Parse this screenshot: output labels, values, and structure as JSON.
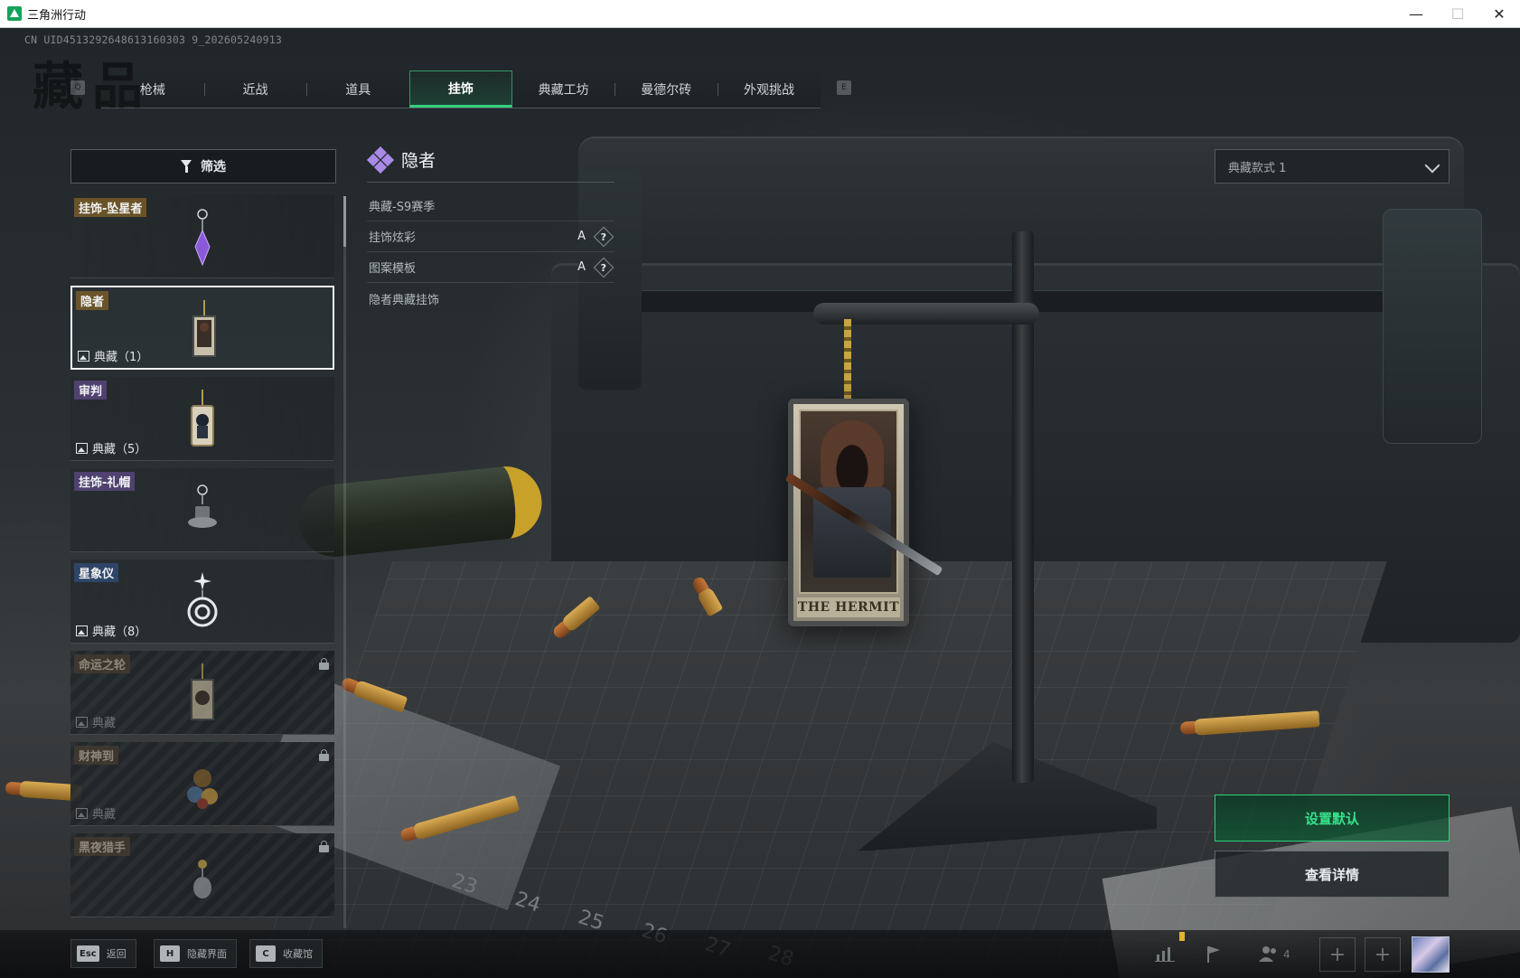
{
  "window": {
    "title": "三角洲行动",
    "controls": {
      "minimize": "—",
      "maximize": "☐",
      "close": "✕"
    }
  },
  "uid": "CN UID4513292648613160303 9_202605240913",
  "page_watermark": "藏品",
  "tab_keys": {
    "left": "Q",
    "right": "E"
  },
  "tabs": [
    {
      "label": "枪械",
      "active": false
    },
    {
      "label": "近战",
      "active": false
    },
    {
      "label": "道具",
      "active": false
    },
    {
      "label": "挂饰",
      "active": true
    },
    {
      "label": "典藏工坊",
      "active": false
    },
    {
      "label": "曼德尔砖",
      "active": false
    },
    {
      "label": "外观挑战",
      "active": false
    }
  ],
  "filter": {
    "label": "筛选"
  },
  "items": [
    {
      "name": "挂饰-坠星者",
      "collect": "",
      "locked": false,
      "selected": false,
      "tag_color": "gold"
    },
    {
      "name": "隐者",
      "collect": "典藏（1）",
      "locked": false,
      "selected": true,
      "tag_color": "gold"
    },
    {
      "name": "审判",
      "collect": "典藏（5）",
      "locked": false,
      "selected": false,
      "tag_color": "purple"
    },
    {
      "name": "挂饰-礼帽",
      "collect": "",
      "locked": false,
      "selected": false,
      "tag_color": "purple"
    },
    {
      "name": "星象仪",
      "collect": "典藏（8）",
      "locked": false,
      "selected": false,
      "tag_color": "blue"
    },
    {
      "name": "命运之轮",
      "collect": "典藏",
      "locked": true,
      "selected": false,
      "tag_color": "dim"
    },
    {
      "name": "财神到",
      "collect": "典藏",
      "locked": true,
      "selected": false,
      "tag_color": "dim"
    },
    {
      "name": "黑夜猎手",
      "collect": "",
      "locked": true,
      "selected": false,
      "tag_color": "dim"
    }
  ],
  "detail": {
    "title": "隐者",
    "rows": [
      {
        "label": "典藏-S9赛季",
        "grade": ""
      },
      {
        "label": "挂饰炫彩",
        "grade": "A"
      },
      {
        "label": "图案模板",
        "grade": "A"
      },
      {
        "label": "隐者典藏挂饰",
        "grade": ""
      }
    ],
    "help_mark": "?"
  },
  "charm": {
    "card_label": "THE HERMIT"
  },
  "ruler_numbers": [
    "23",
    "24",
    "25",
    "26",
    "27",
    "28"
  ],
  "variant_select": {
    "value": "典藏款式 1"
  },
  "buttons": {
    "set_default": "设置默认",
    "view_details": "查看详情"
  },
  "bottom_hotkeys": [
    {
      "key": "Esc",
      "label": "返回"
    },
    {
      "key": "H",
      "label": "隐藏界面"
    },
    {
      "key": "C",
      "label": "收藏馆"
    }
  ],
  "hud": {
    "squad_count": "4",
    "add": "+"
  },
  "colors": {
    "accent_green": "#34d07e",
    "window_bg": "#1b1f22"
  }
}
